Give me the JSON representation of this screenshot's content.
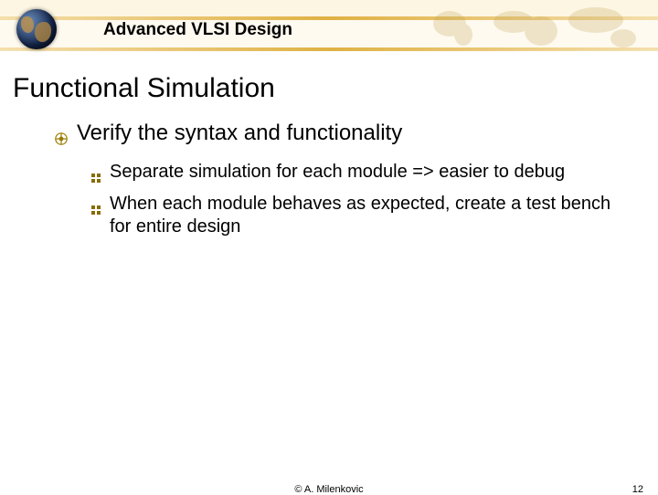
{
  "header": {
    "course_title": "Advanced VLSI Design"
  },
  "slide": {
    "title": "Functional Simulation",
    "bullets_l1": [
      {
        "text": "Verify the syntax and functionality"
      }
    ],
    "bullets_l2": [
      {
        "text": "Separate simulation for each module => easier to debug"
      },
      {
        "text": "When each module behaves as expected, create a test bench for entire design"
      }
    ]
  },
  "footer": {
    "copyright": "© A. Milenkovic",
    "page_number": "12"
  }
}
